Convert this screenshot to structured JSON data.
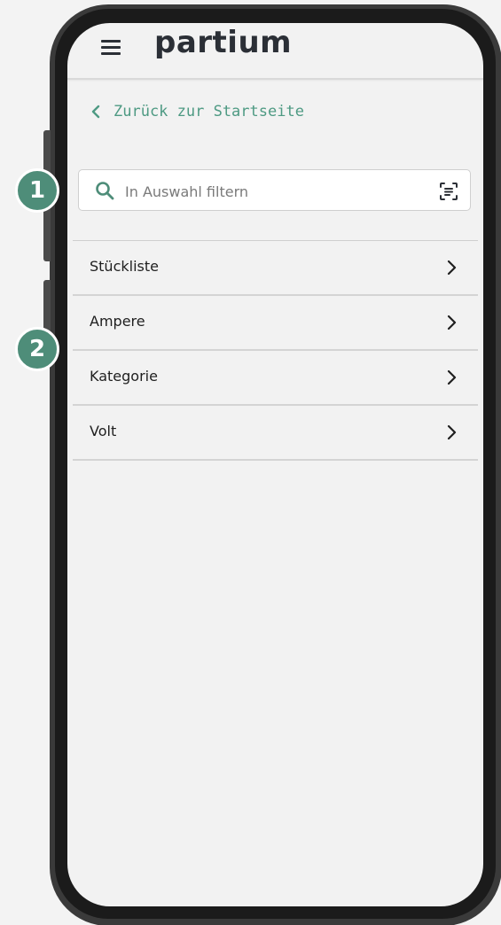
{
  "header": {
    "menu_icon": "hamburger-icon",
    "brand": "partium"
  },
  "nav": {
    "back_label": "Zurück zur Startseite",
    "back_icon": "chevron-left-icon"
  },
  "search": {
    "placeholder": "In Auswahl filtern",
    "value": "",
    "search_icon": "search-icon",
    "scan_icon": "scan-text-icon"
  },
  "filters": {
    "items": [
      {
        "label": "Stückliste"
      },
      {
        "label": "Ampere"
      },
      {
        "label": "Kategorie"
      },
      {
        "label": "Volt"
      }
    ]
  },
  "annotations": {
    "badge_1": "1",
    "badge_2": "2"
  },
  "colors": {
    "accent": "#4e9a83",
    "badge": "#4e8d79",
    "text": "#1f1f1f",
    "brand": "#2b2f36",
    "frame": "#1b1b1b"
  }
}
